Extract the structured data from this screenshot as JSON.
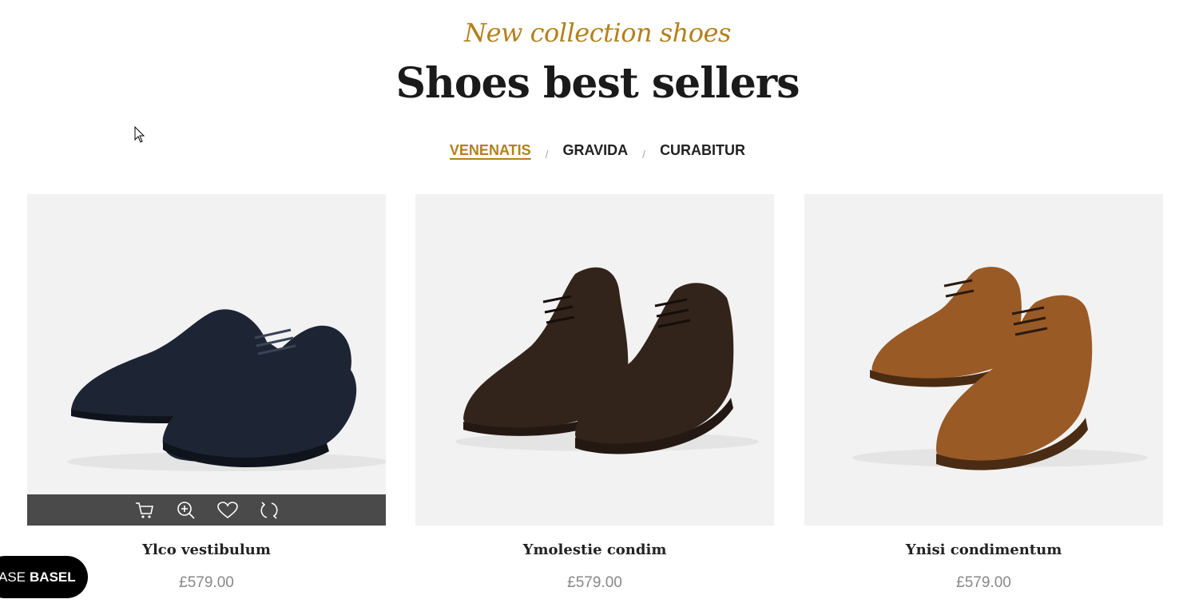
{
  "header": {
    "subtitle": "New collection shoes",
    "title": "Shoes best sellers"
  },
  "tabs": [
    {
      "label": "VENENATIS",
      "active": true
    },
    {
      "label": "GRAVIDA",
      "active": false
    },
    {
      "label": "CURABITUR",
      "active": false
    }
  ],
  "separator": "/",
  "products": [
    {
      "name": "Ylco vestibulum",
      "price": "£579.00",
      "color": "#1d2433"
    },
    {
      "name": "Ymolestie condim",
      "price": "£579.00",
      "color": "#33241b"
    },
    {
      "name": "Ynisi condimentum",
      "price": "£579.00",
      "color": "#9a5a25"
    }
  ],
  "product_actions": [
    "cart-icon",
    "zoom-icon",
    "heart-icon",
    "compare-icon"
  ],
  "badge": {
    "prefix": "ASE",
    "brand": "BASEL"
  },
  "colors": {
    "accent": "#b3811b",
    "action_bar": "#4a4a4a"
  }
}
